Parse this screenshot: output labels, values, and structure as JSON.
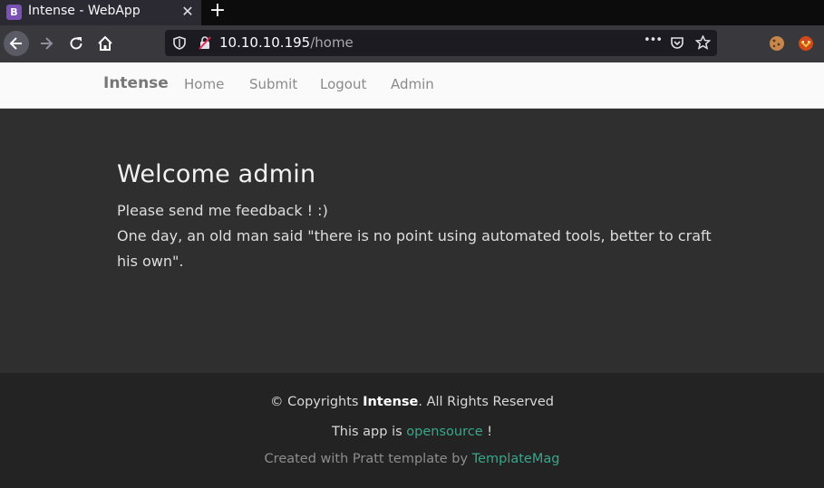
{
  "browser": {
    "tab_favicon_letter": "B",
    "tab_title": "Intense - WebApp",
    "tab_close": "✕",
    "new_tab": "+",
    "url_host": "10.10.10.195",
    "url_path": "/home",
    "page_actions": "•••",
    "colors": {
      "tabbar": "#0c0c0d",
      "toolbar": "#38383d",
      "urlbar": "#1c1b22",
      "favicon": "#7952b3"
    }
  },
  "site_nav": {
    "brand": "Intense",
    "links": [
      "Home",
      "Submit",
      "Logout",
      "Admin"
    ]
  },
  "hero": {
    "heading": "Welcome admin",
    "line1": "Please send me feedback ! :)",
    "line2": "One day, an old man said \"there is no point using automated tools, better to craft his own\"."
  },
  "footer": {
    "copyright_prefix": "© Copyrights ",
    "copyright_brand": "Intense",
    "copyright_suffix": ". All Rights Reserved",
    "app_prefix": "This app is ",
    "app_link": "opensource",
    "app_suffix": " !",
    "created_prefix": "Created with Pratt template by ",
    "created_link": "TemplateMag",
    "colors": {
      "link": "#3aa689",
      "background": "#232323"
    }
  }
}
